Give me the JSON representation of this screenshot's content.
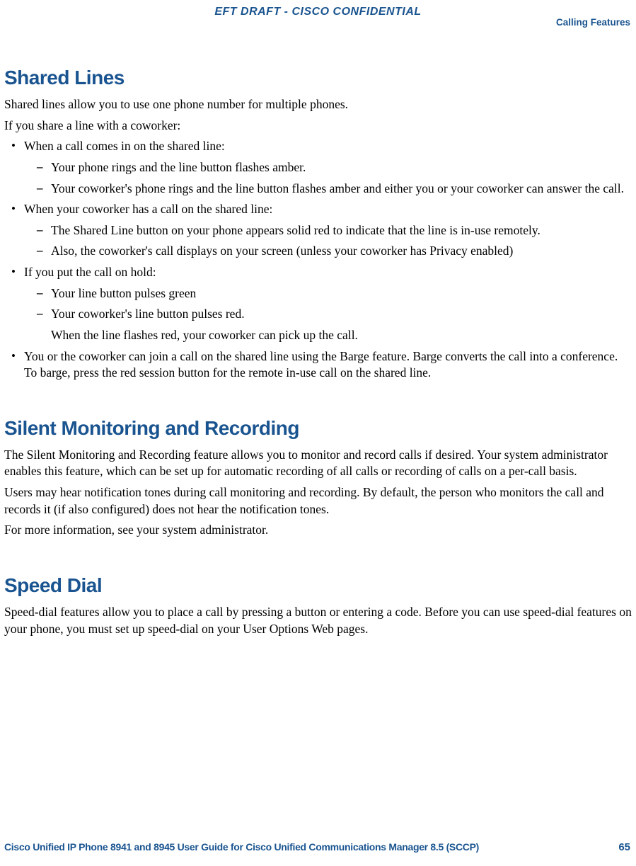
{
  "header": {
    "draft": "EFT DRAFT - CISCO CONFIDENTIAL",
    "section": "Calling Features"
  },
  "sections": {
    "shared_lines": {
      "title": "Shared Lines",
      "p1": "Shared lines allow you to use one phone number for multiple phones.",
      "p2": "If you share a line with a coworker:",
      "b1": "When a call comes in on the shared line:",
      "b1a": "Your phone rings and the line button flashes amber.",
      "b1b": "Your coworker's phone rings and the line button flashes amber and either you or your coworker can answer the call.",
      "b2": "When your coworker has a call on the shared line:",
      "b2a": "The Shared Line button on your phone appears solid red to indicate that the line is in-use remotely.",
      "b2b": "Also, the coworker's call displays on your screen (unless your coworker has Privacy enabled)",
      "b3": "If you put the call on hold:",
      "b3a": "Your line button pulses green",
      "b3b": "Your coworker's line button pulses red.",
      "b3b_note": "When the line flashes red, your coworker can pick up the call.",
      "b4": "You or the coworker can join a call on the shared line using the Barge feature. Barge converts the call into a conference. To barge, press the red session button for the remote in-use call on the shared line."
    },
    "silent": {
      "title": "Silent Monitoring and Recording",
      "p1": "The Silent Monitoring and Recording feature allows you to monitor and record calls if desired. Your system administrator enables this feature, which can be set up for automatic recording of all calls or recording of calls on a per-call basis.",
      "p2": "Users may hear notification tones during call monitoring and recording. By default, the person who monitors the call and records it (if also configured) does not hear the notification tones.",
      "p3": "For more information, see your system administrator."
    },
    "speed_dial": {
      "title": "Speed Dial",
      "p1": "Speed-dial features allow you to place a call by pressing a button or entering a code. Before you can use speed-dial features on your phone, you must set up speed-dial on your User Options Web pages."
    }
  },
  "footer": {
    "title": "Cisco Unified IP Phone 8941 and 8945 User Guide for Cisco Unified Communications Manager 8.5 (SCCP)",
    "page": "65"
  }
}
